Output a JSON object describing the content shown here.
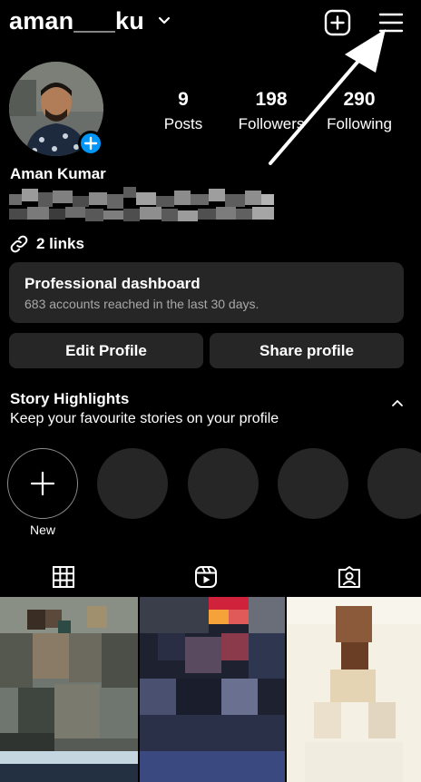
{
  "header": {
    "username": "aman___ku"
  },
  "profile": {
    "stats": [
      {
        "value": "9",
        "label": "Posts"
      },
      {
        "value": "198",
        "label": "Followers"
      },
      {
        "value": "290",
        "label": "Following"
      }
    ],
    "name": "Aman Kumar",
    "links_label": "2 links"
  },
  "dashboard": {
    "title": "Professional dashboard",
    "subtitle": "683 accounts reached in the last 30 days."
  },
  "actions": {
    "edit_label": "Edit Profile",
    "share_label": "Share profile"
  },
  "highlights": {
    "title": "Story Highlights",
    "subtitle": "Keep your favourite stories on your profile",
    "new_label": "New"
  },
  "icons": {
    "new_post": "plus-square-icon",
    "menu": "hamburger-menu-icon",
    "links": "link-icon",
    "tab_grid": "grid-icon",
    "tab_reels": "reels-icon",
    "tab_tagged": "tagged-icon"
  },
  "colors": {
    "background": "#000000",
    "card": "#262626",
    "accent": "#0095f6",
    "secondary_text": "#a8a8a8"
  }
}
